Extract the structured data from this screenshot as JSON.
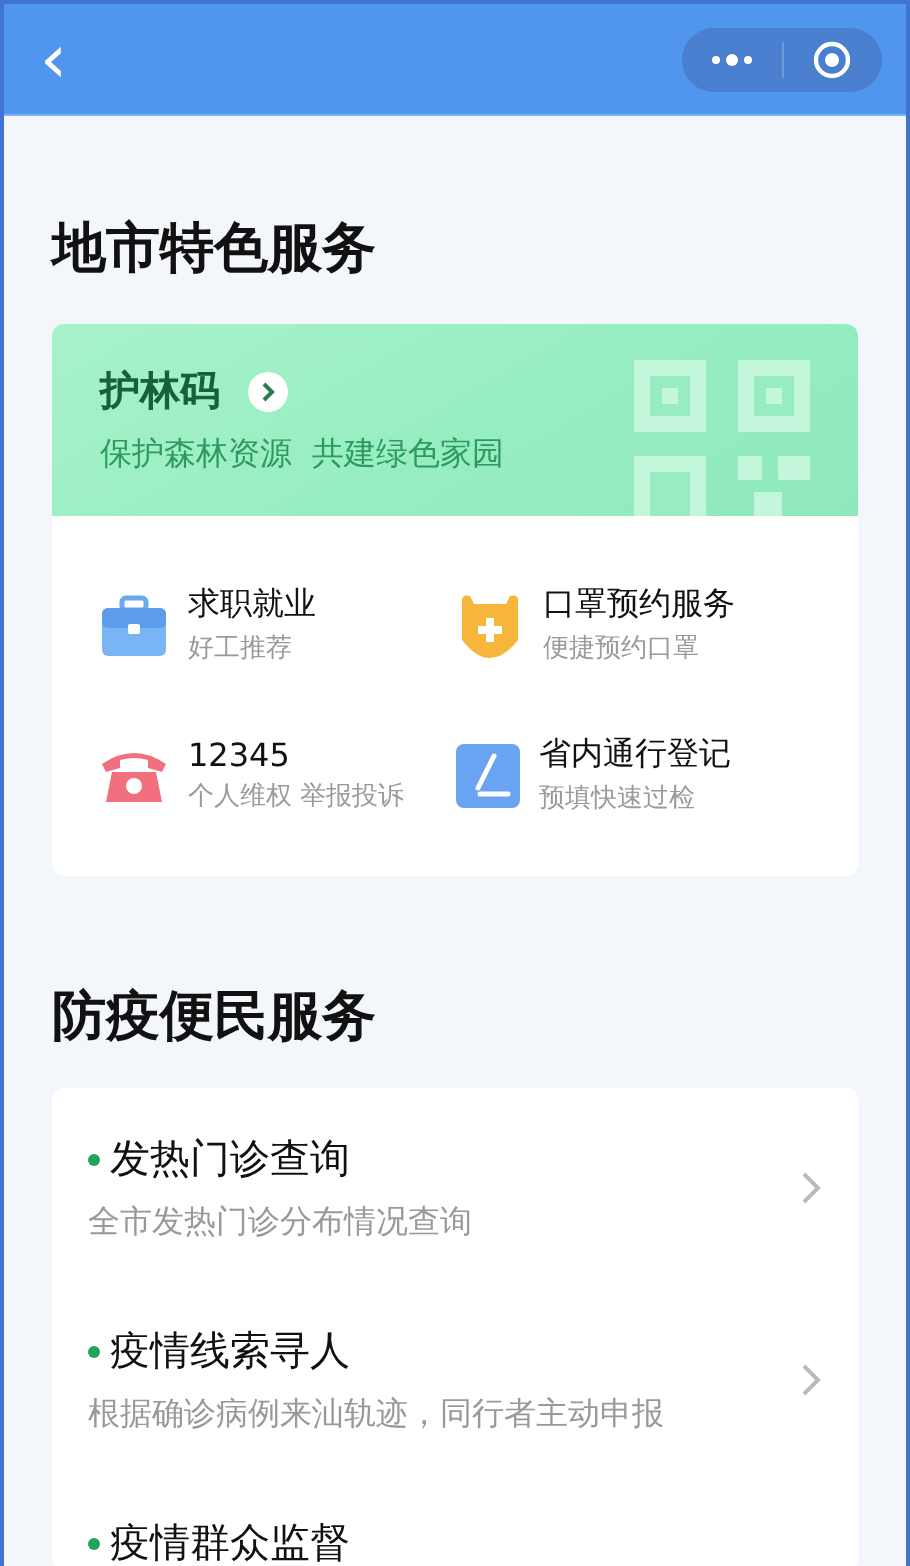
{
  "nav_bar": {
    "back": "‹"
  },
  "section_1": {
    "title": "地市特色服务",
    "banner": {
      "title": "护林码",
      "subtitle": "保护森林资源  共建绿色家园"
    },
    "services": [
      {
        "kind": "briefcase",
        "title": "求职就业",
        "subtitle": "好工推荐"
      },
      {
        "kind": "mask",
        "title": "口罩预约服务",
        "subtitle": "便捷预约口罩"
      },
      {
        "kind": "phone",
        "title": "12345",
        "subtitle": "个人维权 举报投诉"
      },
      {
        "kind": "pen",
        "title": "省内通行登记",
        "subtitle": "预填快速过检"
      }
    ]
  },
  "section_2": {
    "title": "防疫便民服务",
    "items": [
      {
        "title": "发热门诊查询",
        "subtitle": "全市发热门诊分布情况查询"
      },
      {
        "title": "疫情线索寻人",
        "subtitle": "根据确诊病例来汕轨迹，同行者主动申报"
      },
      {
        "title": "疫情群众监督"
      }
    ]
  }
}
